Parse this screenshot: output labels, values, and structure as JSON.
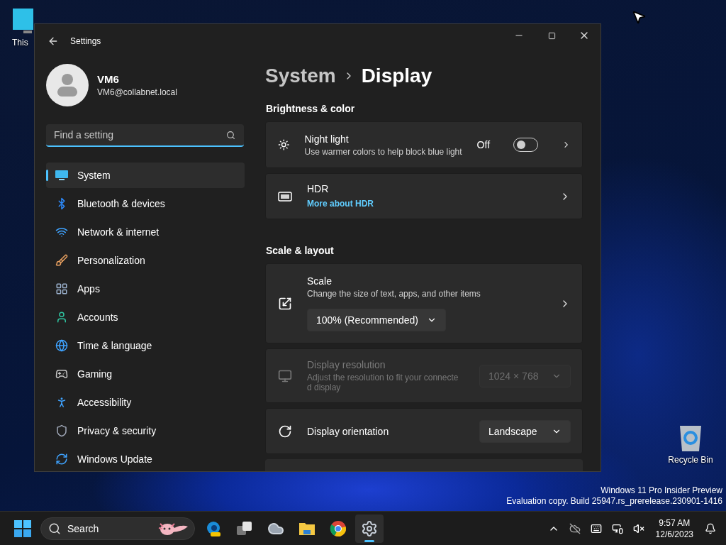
{
  "desktop": {
    "icons": [
      {
        "kind": "computer",
        "label": "This"
      },
      {
        "kind": "recycle",
        "label": "Recycle Bin"
      }
    ],
    "watermark": [
      "Windows 11 Pro Insider Preview",
      "Evaluation copy. Build 25947.rs_prerelease.230901-1416"
    ]
  },
  "window": {
    "title": "Settings"
  },
  "account": {
    "name": "VM6",
    "email": "VM6@collabnet.local"
  },
  "search": {
    "placeholder": "Find a setting"
  },
  "sidebar": {
    "items": [
      {
        "label": "System",
        "selected": true
      },
      {
        "label": "Bluetooth & devices",
        "selected": false
      },
      {
        "label": "Network & internet",
        "selected": false
      },
      {
        "label": "Personalization",
        "selected": false
      },
      {
        "label": "Apps",
        "selected": false
      },
      {
        "label": "Accounts",
        "selected": false
      },
      {
        "label": "Time & language",
        "selected": false
      },
      {
        "label": "Gaming",
        "selected": false
      },
      {
        "label": "Accessibility",
        "selected": false
      },
      {
        "label": "Privacy & security",
        "selected": false
      },
      {
        "label": "Windows Update",
        "selected": false
      }
    ]
  },
  "breadcrumb": {
    "parent": "System",
    "current": "Display"
  },
  "sections": [
    {
      "title": "Brightness & color",
      "cards": [
        {
          "kind": "toggle",
          "title": "Night light",
          "description": "Use warmer colors to help block blue light",
          "state_label": "Off",
          "on": false,
          "disabled": false
        },
        {
          "kind": "link",
          "title": "HDR",
          "link": "More about HDR",
          "disabled": false
        }
      ]
    },
    {
      "title": "Scale & layout",
      "cards": [
        {
          "kind": "inline_dropdown",
          "title": "Scale",
          "description": "Change the size of text, apps, and other items",
          "value": "100% (Recommended)",
          "disabled": false
        },
        {
          "kind": "dropdown",
          "title": "Display resolution",
          "description": "Adjust the resolution to fit your connecte d display",
          "value": "1024 × 768",
          "disabled": true
        },
        {
          "kind": "dropdown",
          "title": "Display orientation",
          "value": "Landscape",
          "disabled": false
        }
      ]
    }
  ],
  "taskbar": {
    "search_placeholder": "Search",
    "apps": [
      {
        "kind": "edge",
        "selected": false
      },
      {
        "kind": "taskview",
        "selected": false
      },
      {
        "kind": "weather",
        "selected": false
      },
      {
        "kind": "explorer",
        "selected": false
      },
      {
        "kind": "chrome",
        "selected": false
      },
      {
        "kind": "settings",
        "selected": true
      }
    ],
    "clock": {
      "time": "9:57 AM",
      "date": "12/6/2023"
    }
  }
}
